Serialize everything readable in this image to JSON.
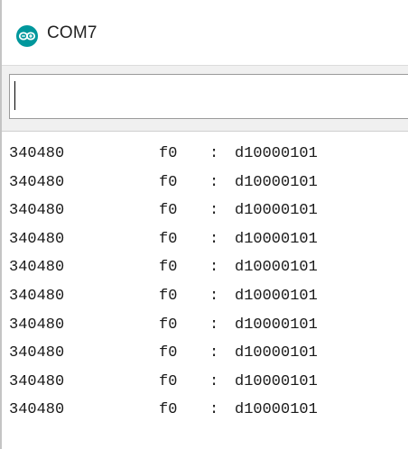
{
  "window": {
    "title": "COM7",
    "icon": "arduino-logo-icon",
    "accent_color": "#00979c"
  },
  "send_input": {
    "value": ""
  },
  "serial_output": {
    "lines": [
      {
        "count": "340480",
        "reg": "f0",
        "sep": ":",
        "value": "d10000101"
      },
      {
        "count": "340480",
        "reg": "f0",
        "sep": ":",
        "value": "d10000101"
      },
      {
        "count": "340480",
        "reg": "f0",
        "sep": ":",
        "value": "d10000101"
      },
      {
        "count": "340480",
        "reg": "f0",
        "sep": ":",
        "value": "d10000101"
      },
      {
        "count": "340480",
        "reg": "f0",
        "sep": ":",
        "value": "d10000101"
      },
      {
        "count": "340480",
        "reg": "f0",
        "sep": ":",
        "value": "d10000101"
      },
      {
        "count": "340480",
        "reg": "f0",
        "sep": ":",
        "value": "d10000101"
      },
      {
        "count": "340480",
        "reg": "f0",
        "sep": ":",
        "value": "d10000101"
      },
      {
        "count": "340480",
        "reg": "f0",
        "sep": ":",
        "value": "d10000101"
      },
      {
        "count": "340480",
        "reg": "f0",
        "sep": ":",
        "value": "d10000101"
      }
    ]
  }
}
